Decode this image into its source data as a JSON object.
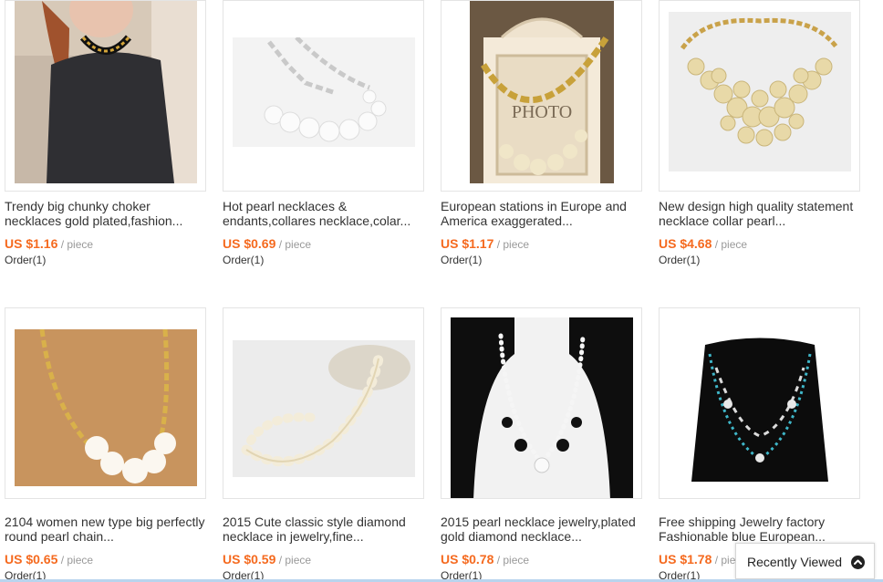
{
  "products": [
    {
      "title": "Trendy big chunky choker necklaces gold plated,fashion...",
      "price": "US $1.16",
      "unit": "/ piece",
      "orders": "Order(1)"
    },
    {
      "title": "Hot pearl necklaces & endants,collares necklace,colar...",
      "price": "US $0.69",
      "unit": "/ piece",
      "orders": "Order(1)"
    },
    {
      "title": "European stations in Europe and America exaggerated...",
      "price": "US $1.17",
      "unit": "/ piece",
      "orders": "Order(1)"
    },
    {
      "title": "New design high quality statement necklace collar pearl...",
      "price": "US $4.68",
      "unit": "/ piece",
      "orders": "Order(1)"
    },
    {
      "title": "2104 women new type big perfectly round pearl chain...",
      "price": "US $0.65",
      "unit": "/ piece",
      "orders": "Order(1)"
    },
    {
      "title": "2015 Cute classic style diamond necklace in jewelry,fine...",
      "price": "US $0.59",
      "unit": "/ piece",
      "orders": "Order(1)"
    },
    {
      "title": "2015 pearl necklace jewelry,plated gold diamond necklace...",
      "price": "US $0.78",
      "unit": "/ piece",
      "orders": "Order(1)"
    },
    {
      "title": "Free shipping Jewelry factory Fashionable blue European...",
      "price": "US $1.78",
      "unit": "/ piece",
      "orders": "Order(1)"
    }
  ],
  "image_text": {
    "photo_frame": "PHOTO"
  },
  "recently_viewed": {
    "label": "Recently Viewed",
    "icon": "chevron-up-icon"
  },
  "colors": {
    "price": "#f56a1f",
    "title": "#333333",
    "muted": "#999999",
    "border": "#e4e4e4"
  }
}
